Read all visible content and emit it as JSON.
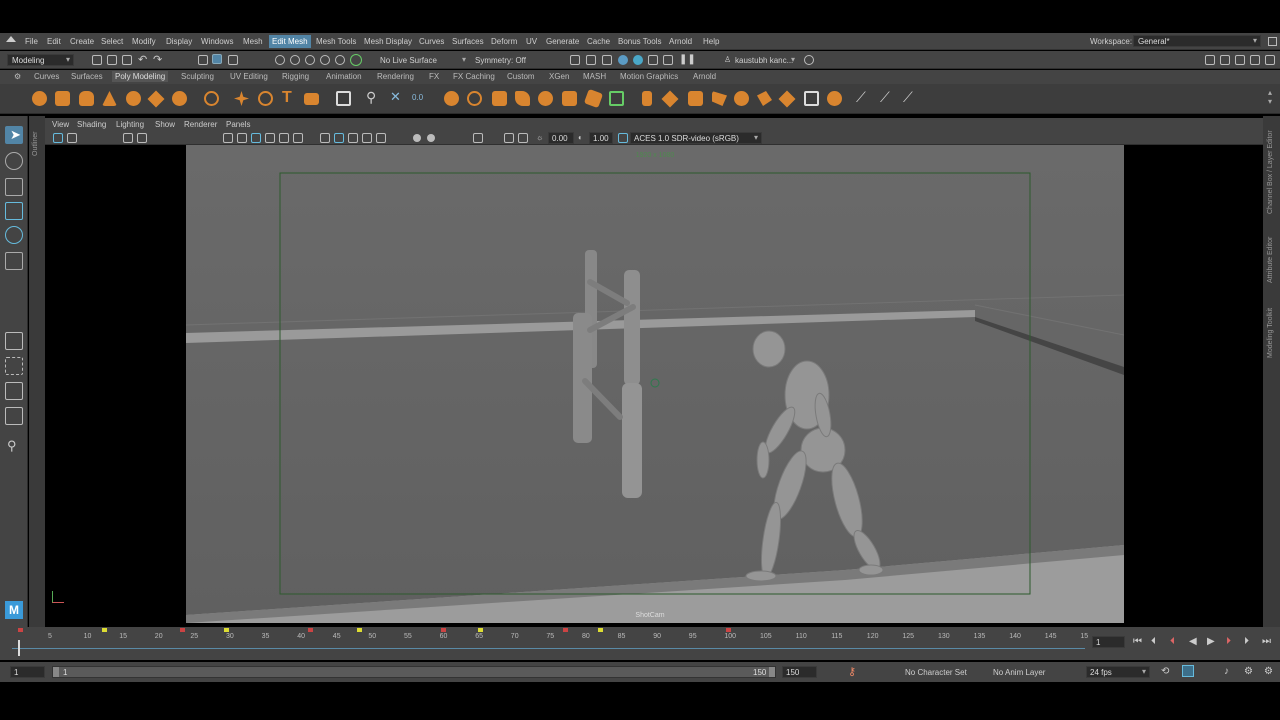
{
  "menubar": {
    "items": [
      "File",
      "Edit",
      "Create",
      "Select",
      "Modify",
      "Display",
      "Windows",
      "Mesh",
      "Edit Mesh",
      "Mesh Tools",
      "Mesh Display",
      "Curves",
      "Surfaces",
      "Deform",
      "UV",
      "Generate",
      "Cache",
      "Bonus Tools",
      "Arnold",
      "Help"
    ],
    "active": "Edit Mesh",
    "workspace_label": "Workspace:",
    "workspace_value": "General*"
  },
  "statusline": {
    "mode": "Modeling",
    "live_surface": "No Live Surface",
    "symmetry": "Symmetry: Off",
    "user": "kaustubh kanc..."
  },
  "shelf": {
    "tabs": [
      "Curves",
      "Surfaces",
      "Poly Modeling",
      "Sculpting",
      "UV Editing",
      "Rigging",
      "Animation",
      "Rendering",
      "FX",
      "FX Caching",
      "Custom",
      "XGen",
      "MASH",
      "Motion Graphics",
      "Arnold"
    ],
    "selected": "Poly Modeling"
  },
  "viewport": {
    "menus": [
      "View",
      "Shading",
      "Lighting",
      "Show",
      "Renderer",
      "Panels"
    ],
    "exposure": "0.00",
    "gamma": "1.00",
    "color_space": "ACES 1.0 SDR-video (sRGB)",
    "resolution": "1920 x 1080",
    "camera": "ShotCam",
    "left_dock_label": "Outliner",
    "right_dock": [
      "Channel Box / Layer Editor",
      "Attribute Editor",
      "Modeling Toolkit"
    ],
    "logo": "M"
  },
  "timeline": {
    "ticks": [
      "5",
      "10",
      "15",
      "20",
      "25",
      "30",
      "35",
      "40",
      "45",
      "50",
      "55",
      "60",
      "65",
      "70",
      "75",
      "80",
      "85",
      "90",
      "95",
      "100",
      "105",
      "110",
      "115",
      "120",
      "125",
      "130",
      "135",
      "140",
      "145",
      "15"
    ],
    "current_frame": "1"
  },
  "range": {
    "start": "1",
    "anim_start": "1",
    "range_end": "150",
    "anim_end": "150",
    "character_set": "No Character Set",
    "anim_layer": "No Anim Layer",
    "fps": "24 fps"
  }
}
